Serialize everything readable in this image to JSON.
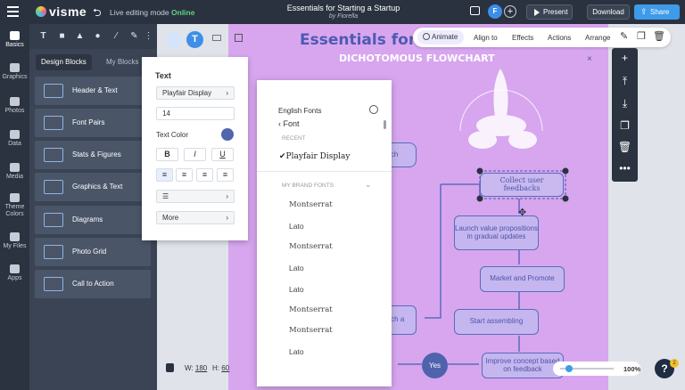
{
  "header": {
    "logo": "visme",
    "live_mode_text": "Live editing mode",
    "live_mode_status": "Online",
    "doc_title": "Essentials for Starting a Startup",
    "doc_author": "by Fiorella",
    "avatar_initial": "F",
    "add_collab": "+",
    "present_label": "Present",
    "download_label": "Download",
    "share_label": "Share"
  },
  "rail": {
    "items": [
      {
        "label": "Basics"
      },
      {
        "label": "Graphics"
      },
      {
        "label": "Photos"
      },
      {
        "label": "Data"
      },
      {
        "label": "Media"
      },
      {
        "label": "Theme Colors"
      },
      {
        "label": "My Files"
      },
      {
        "label": "Apps"
      }
    ]
  },
  "panel": {
    "tabs": [
      {
        "label": "Design Blocks"
      },
      {
        "label": "My Blocks"
      }
    ],
    "blocks": [
      {
        "label": "Header & Text"
      },
      {
        "label": "Font Pairs"
      },
      {
        "label": "Stats & Figures"
      },
      {
        "label": "Graphics & Text"
      },
      {
        "label": "Diagrams"
      },
      {
        "label": "Photo Grid"
      },
      {
        "label": "Call to Action"
      }
    ]
  },
  "text_panel": {
    "heading": "Text",
    "font_value": "Playfair Display",
    "size_value": "14",
    "color_label": "Text Color",
    "color_value": "#4f66ad",
    "bold": "B",
    "italic": "I",
    "underline": "U",
    "more_label": "More"
  },
  "font_dropdown": {
    "section_label": "English Fonts",
    "back_label": "Font",
    "recent_label": "RECENT",
    "recent_font": "Playfair Display",
    "brand_label": "MY BRAND FONTS",
    "fonts": [
      "Montserrat",
      "Lato",
      "Montserrat",
      "Lato",
      "Lato",
      "Montserrat",
      "Montserrat",
      "Lato"
    ]
  },
  "context_toolbar": {
    "animate": "Animate",
    "align": "Align to",
    "effects": "Effects",
    "actions": "Actions",
    "arrange": "Arrange"
  },
  "canvas": {
    "title": "Essentials for St",
    "subtitle": "DICHOTOMOUS FLOWCHART",
    "nodes": {
      "research": "arch",
      "collect": "Collect user feedbacks",
      "launch": "Launch value propositions in gradual updates",
      "market": "Market and Promote",
      "assemble": "Start assembling",
      "launch_left": "nch a",
      "improve": "Improve concept based on feedback",
      "yes": "Yes"
    }
  },
  "bottom": {
    "w_label": "W:",
    "w_value": "180",
    "h_label": "H:",
    "h_value": "60",
    "zoom": "100%",
    "help": "?",
    "help_badge": "2"
  },
  "colors": {
    "topbar": "#2a3240",
    "accent": "#3d9be9",
    "page_bg": "#d7a6ef",
    "node_border": "#5b6bbd"
  }
}
